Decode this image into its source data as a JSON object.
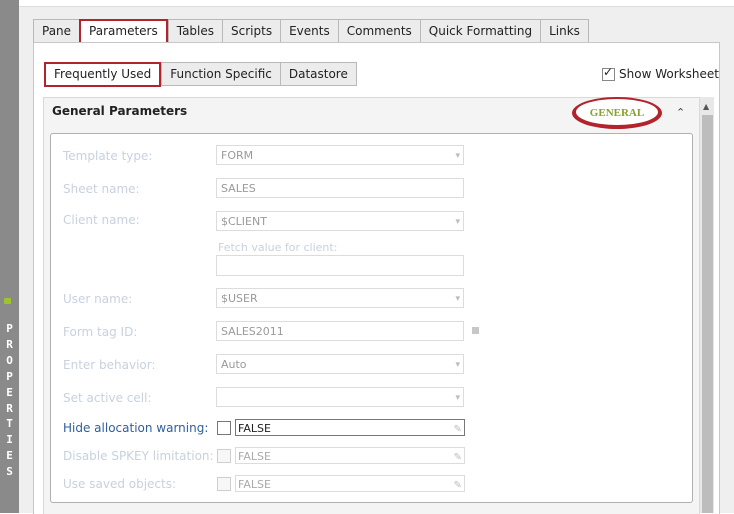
{
  "sidebar": {
    "label": "PROPERTIES",
    "letters": [
      "P",
      "R",
      "O",
      "P",
      "E",
      "R",
      "T",
      "I",
      "E",
      "S"
    ]
  },
  "tabs": [
    {
      "label": "Pane"
    },
    {
      "label": "Parameters",
      "active": true
    },
    {
      "label": "Tables"
    },
    {
      "label": "Scripts"
    },
    {
      "label": "Events"
    },
    {
      "label": "Comments"
    },
    {
      "label": "Quick Formatting"
    },
    {
      "label": "Links"
    }
  ],
  "subtabs": [
    {
      "label": "Frequently Used",
      "active": true
    },
    {
      "label": "Function Specific"
    },
    {
      "label": "Datastore"
    }
  ],
  "show_worksheet": {
    "label": "Show Worksheet",
    "checked": true
  },
  "section": {
    "title": "General Parameters",
    "badge": "GENERAL"
  },
  "fields": {
    "template_type": {
      "label": "Template type:",
      "value": "FORM"
    },
    "sheet_name": {
      "label": "Sheet name:",
      "value": "SALES"
    },
    "client_name": {
      "label": "Client name:",
      "value": "$CLIENT"
    },
    "fetch_value": {
      "label": "Fetch value for client:",
      "value": ""
    },
    "user_name": {
      "label": "User name:",
      "value": "$USER"
    },
    "form_tag_id": {
      "label": "Form tag ID:",
      "value": "SALES2011"
    },
    "enter_behavior": {
      "label": "Enter behavior:",
      "value": "Auto"
    },
    "set_active_cell": {
      "label": "Set active cell:",
      "value": ""
    },
    "hide_allocation": {
      "label": "Hide allocation warning:",
      "value": "FALSE"
    },
    "disable_spkey": {
      "label": "Disable SPKEY limitation:",
      "value": "FALSE"
    },
    "use_saved": {
      "label": "Use saved objects:",
      "value": "FALSE"
    }
  },
  "icons": {
    "checkmark": "check-icon",
    "collapse": "chevron-up-icon",
    "dropdown": "chevron-down-icon",
    "edit": "pencil-icon"
  },
  "colors": {
    "accent": "#b3232b",
    "badge_text": "#8aa12a",
    "enabled_label": "#2e5f9e",
    "sidebar": "#8a8a8a"
  }
}
